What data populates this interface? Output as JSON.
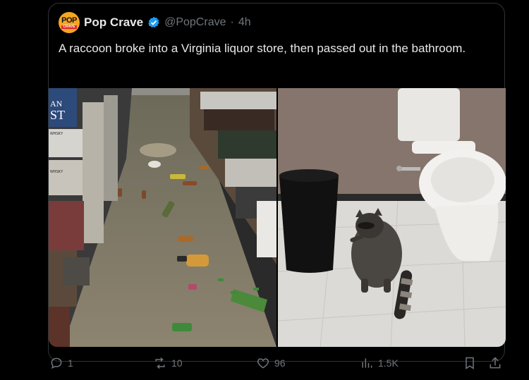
{
  "tweet": {
    "display_name": "Pop Crave",
    "handle": "@PopCrave",
    "separator": "·",
    "time": "4h",
    "text": "A raccoon broke into a Virginia liquor store, then passed out in the bathroom.",
    "avatar": {
      "top_text": "POP",
      "bottom_text": "CRAVE"
    }
  },
  "media": [
    {
      "icon": "liquor-store-aisle-photo",
      "signs": [
        "AN",
        "ST",
        "WHSKY",
        "WHSKY"
      ]
    },
    {
      "icon": "raccoon-bathroom-photo"
    }
  ],
  "actions": {
    "replies": "1",
    "reposts": "10",
    "likes": "96",
    "views": "1.5K"
  },
  "colors": {
    "background": "#000000",
    "border": "#2f3336",
    "muted": "#71767b",
    "verified": "#1d9bf0"
  }
}
